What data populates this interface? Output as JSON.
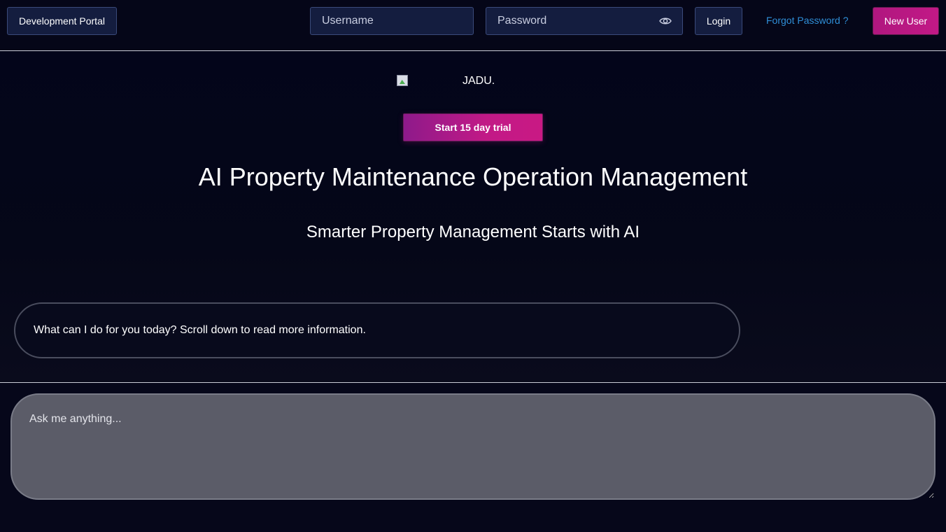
{
  "header": {
    "dev_portal_label": "Development Portal",
    "username_placeholder": "Username",
    "password_placeholder": "Password",
    "login_label": "Login",
    "forgot_label": "Forgot Password ?",
    "new_user_label": "New User"
  },
  "hero": {
    "logo_alt": "JADU.",
    "trial_label": "Start 15 day trial",
    "title": "AI Property Maintenance Operation Management",
    "subtitle": "Smarter Property Management Starts with AI"
  },
  "chat": {
    "message": "What can I do for you today? Scroll down to read more information.",
    "input_placeholder": "Ask me anything..."
  },
  "colors": {
    "background": "#06071a",
    "accent_pink": "#c21986",
    "link_blue": "#2f8fd8",
    "field_bg": "#141d3f"
  },
  "icons": {
    "password_toggle": "eye-icon",
    "logo_image": "broken-image-icon"
  }
}
